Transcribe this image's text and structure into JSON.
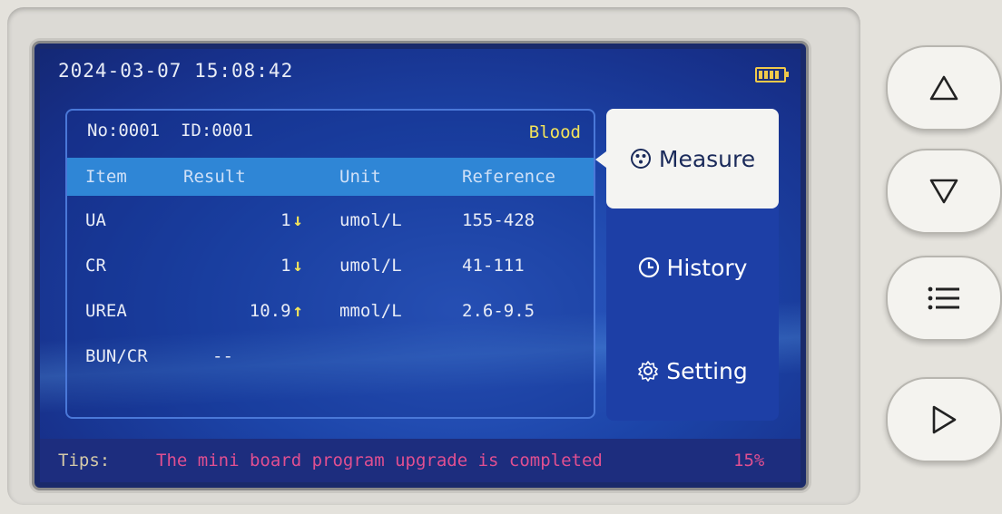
{
  "status_bar": {
    "datetime": "2024-03-07 15:08:42",
    "battery_icon": "battery-icon"
  },
  "panel": {
    "record": "No:0001  ID:0001",
    "sample_type": "Blood"
  },
  "table": {
    "headers": {
      "item": "Item",
      "result": "Result",
      "unit": "Unit",
      "reference": "Reference"
    },
    "rows": [
      {
        "item": "UA",
        "result": "1",
        "flag": "↓",
        "unit": "umol/L",
        "reference": "155-428"
      },
      {
        "item": "CR",
        "result": "1",
        "flag": "↓",
        "unit": "umol/L",
        "reference": "41-111"
      },
      {
        "item": "UREA",
        "result": "10.9",
        "flag": "↑",
        "unit": "mmol/L",
        "reference": "2.6-9.5"
      },
      {
        "item": "BUN/CR",
        "result": "--",
        "flag": "",
        "unit": "",
        "reference": ""
      }
    ]
  },
  "menu": {
    "items": [
      {
        "label": "Measure",
        "icon": "measure-icon",
        "active": true
      },
      {
        "label": "History",
        "icon": "clock-icon",
        "active": false
      },
      {
        "label": "Setting",
        "icon": "gear-icon",
        "active": false
      }
    ]
  },
  "tips": {
    "label": "Tips:",
    "message": "The mini board program upgrade is completed",
    "progress": "15%"
  },
  "hardware_buttons": [
    "up-arrow-icon",
    "down-arrow-icon",
    "list-icon",
    "play-icon"
  ],
  "colors": {
    "screen_blue": "#1c44a8",
    "header_blue": "#2f86d6",
    "flag_yellow": "#f3e45a",
    "tips_pink": "#e04f91"
  }
}
